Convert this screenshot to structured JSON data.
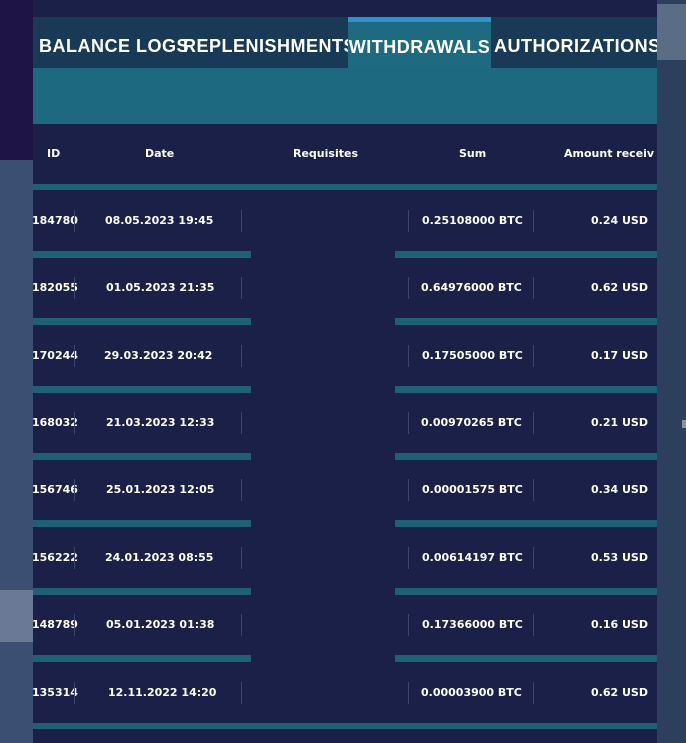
{
  "tabs": [
    {
      "label": "BALANCE LOGS",
      "active": false
    },
    {
      "label": "REPLENISHMENTS",
      "active": false
    },
    {
      "label": "WITHDRAWALS",
      "active": true
    },
    {
      "label": "AUTHORIZATIONS",
      "active": false
    }
  ],
  "table": {
    "headers": {
      "id": "ID",
      "date": "Date",
      "requisites": "Requisites",
      "sum": "Sum",
      "amount_received": "Amount receiv"
    },
    "rows": [
      {
        "id": "184780",
        "date": "08.05.2023 19:45",
        "requisites": "",
        "sum": "0.25108000 BTC",
        "amount": "0.24 USD"
      },
      {
        "id": "182055",
        "date": "01.05.2023 21:35",
        "requisites": "",
        "sum": "0.64976000 BTC",
        "amount": "0.62 USD"
      },
      {
        "id": "170244",
        "date": "29.03.2023 20:42",
        "requisites": "",
        "sum": "0.17505000 BTC",
        "amount": "0.17 USD"
      },
      {
        "id": "168032",
        "date": "21.03.2023 12:33",
        "requisites": "",
        "sum": "0.00970265 BTC",
        "amount": "0.21 USD"
      },
      {
        "id": "156746",
        "date": "25.01.2023 12:05",
        "requisites": "",
        "sum": "0.00001575 BTC",
        "amount": "0.34 USD"
      },
      {
        "id": "156222",
        "date": "24.01.2023 08:55",
        "requisites": "",
        "sum": "0.00614197 BTC",
        "amount": "0.53 USD"
      },
      {
        "id": "148789",
        "date": "05.01.2023 01:38",
        "requisites": "",
        "sum": "0.17366000 BTC",
        "amount": "0.16 USD"
      },
      {
        "id": "135314",
        "date": "12.11.2022 14:20",
        "requisites": "",
        "sum": "0.00003900 BTC",
        "amount": "0.62 USD"
      }
    ]
  },
  "colors": {
    "panel": "#1a2048",
    "tab_bar": "#183a57",
    "active_tab": "#1e6a80",
    "active_accent": "#2f93c8",
    "separator": "#1d6176"
  }
}
